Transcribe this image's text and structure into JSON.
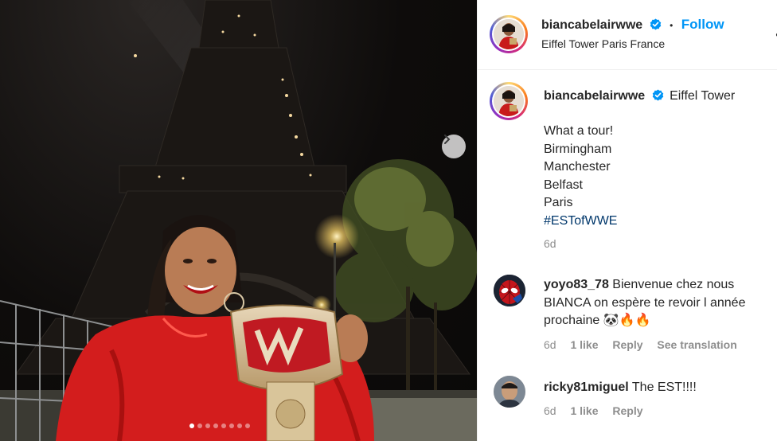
{
  "post": {
    "author": "biancabelairwwe",
    "location": "Eiffel Tower Paris France",
    "follow_label": "Follow",
    "separator": "•",
    "more_label": "•",
    "caption_location": "Eiffel Tower",
    "caption_lines": [
      "What a tour!",
      "Birmingham",
      "Manchester",
      "Belfast",
      "Paris"
    ],
    "hashtag": "#ESTofWWE",
    "age": "6d"
  },
  "carousel": {
    "slide_count": 8,
    "active_index": 0
  },
  "comments": [
    {
      "user": "yoyo83_78",
      "text_line1": "Bienvenue chez nous",
      "text_line2": "BIANCA on espère te revoir l année",
      "text_line3": "prochaine 🐼🔥🔥",
      "age": "6d",
      "likes": "1 like",
      "reply": "Reply",
      "translate": "See translation"
    },
    {
      "user": "ricky81miguel",
      "text": "The EST!!!!",
      "age": "6d",
      "likes": "1 like",
      "reply": "Reply"
    }
  ],
  "colors": {
    "accent": "#0095f6",
    "verified": "#0095f6",
    "hashtag": "#00376b",
    "muted": "#8e8e8e",
    "jacket": "#d31d1d"
  }
}
